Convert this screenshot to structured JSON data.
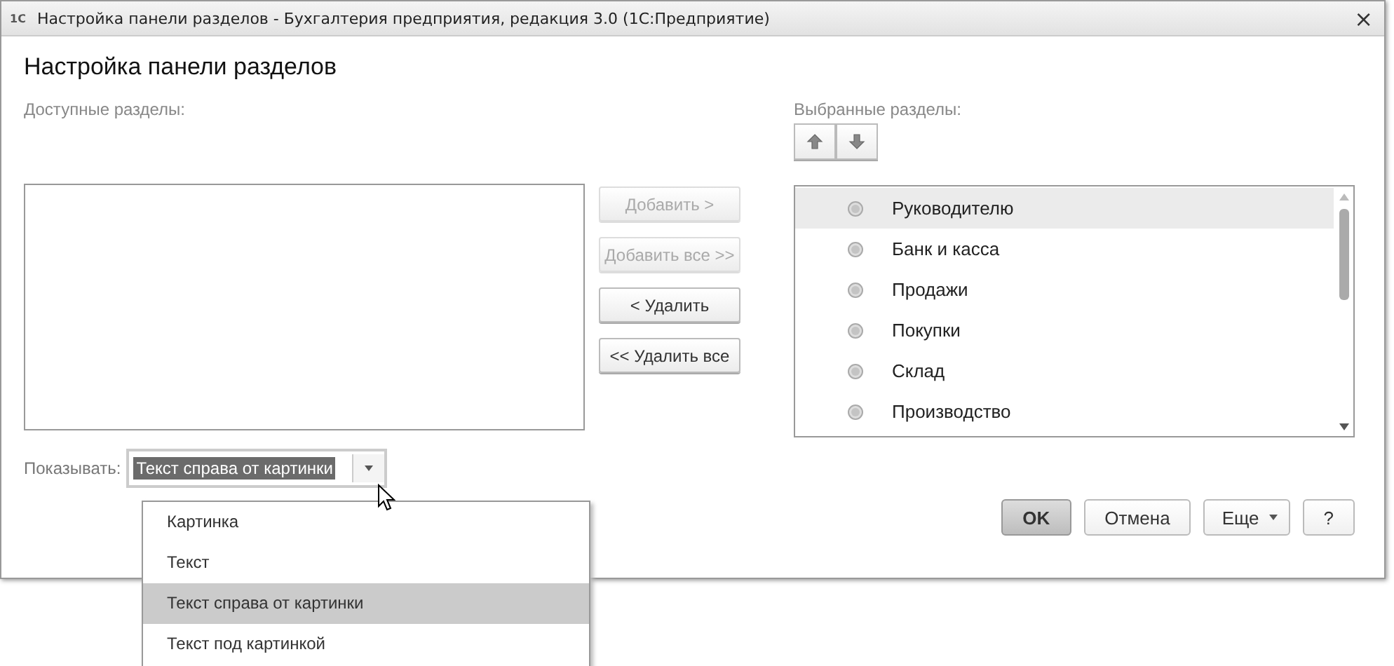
{
  "window": {
    "app_icon": "1С",
    "title": "Настройка панели разделов - Бухгалтерия предприятия, редакция 3.0  (1С:Предприятие)",
    "close": "×"
  },
  "heading": "Настройка панели разделов",
  "available": {
    "label": "Доступные разделы:"
  },
  "transfer_buttons": [
    {
      "label": "Добавить >",
      "disabled": true
    },
    {
      "label": "Добавить все >>",
      "disabled": true
    },
    {
      "label": "< Удалить",
      "disabled": false
    },
    {
      "label": "<< Удалить все",
      "disabled": false
    }
  ],
  "selected_sections": {
    "label": "Выбранные разделы:",
    "items": [
      {
        "label": "Руководителю",
        "selected": true
      },
      {
        "label": "Банк и касса",
        "selected": false
      },
      {
        "label": "Продажи",
        "selected": false
      },
      {
        "label": "Покупки",
        "selected": false
      },
      {
        "label": "Склад",
        "selected": false
      },
      {
        "label": "Производство",
        "selected": false
      }
    ]
  },
  "show": {
    "label": "Показывать:",
    "value": "Текст справа от картинки",
    "options": [
      {
        "label": "Картинка",
        "selected": false
      },
      {
        "label": "Текст",
        "selected": false
      },
      {
        "label": "Текст справа от картинки",
        "selected": true
      },
      {
        "label": "Текст под картинкой",
        "selected": false
      }
    ]
  },
  "footer_buttons": [
    {
      "label": "OK",
      "kind": "default"
    },
    {
      "label": "Отмена",
      "kind": "plain"
    },
    {
      "label": "Еще",
      "kind": "menu"
    },
    {
      "label": "?",
      "kind": "plain"
    }
  ]
}
